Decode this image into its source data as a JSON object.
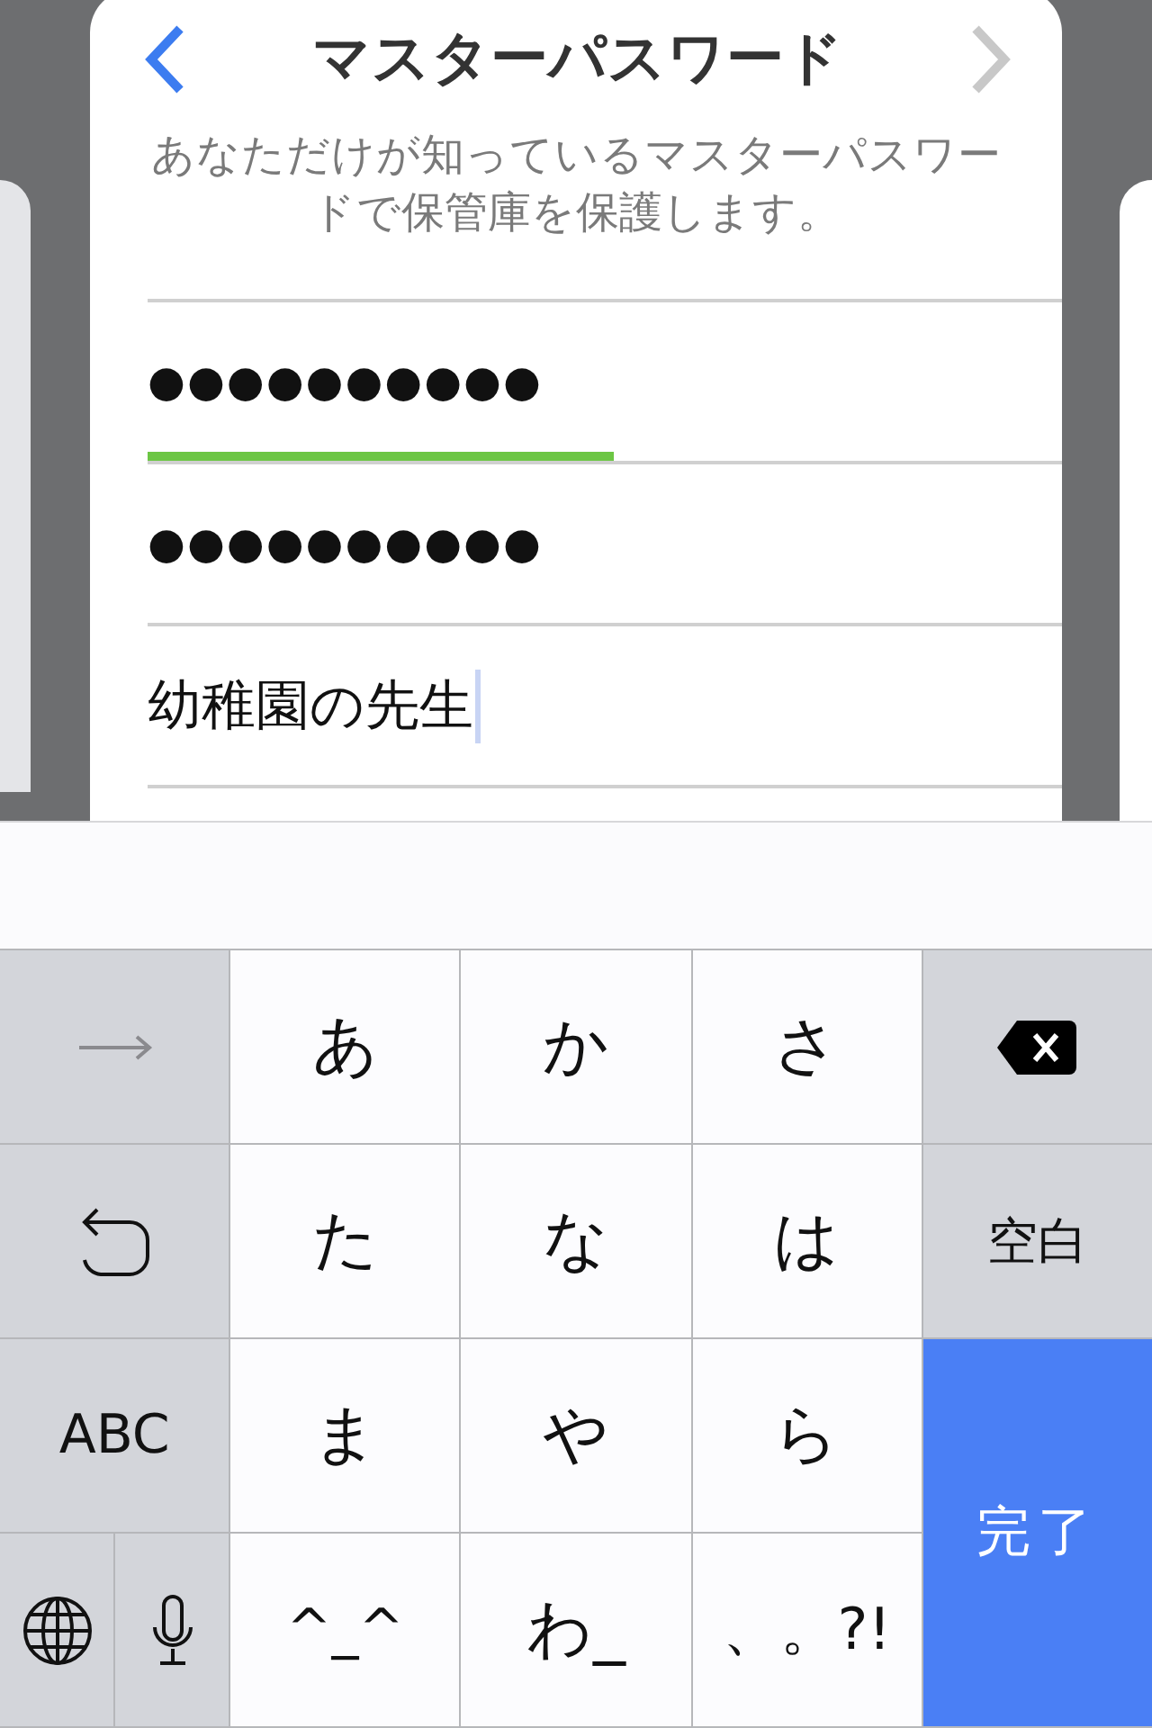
{
  "nav": {
    "title": "マスターパスワード",
    "back_enabled": true,
    "next_enabled": false
  },
  "description": "あなただけが知っているマスターパスワードで保管庫を保護します。",
  "fields": [
    {
      "kind": "password",
      "value": "●●●●●●●●●●",
      "focused": false,
      "level": 0.51
    },
    {
      "kind": "password",
      "value": "●●●●●●●●●●",
      "focused": false
    },
    {
      "kind": "text",
      "value": "幼稚園の先生",
      "focused": true
    }
  ],
  "keyboard": {
    "kana_keys": [
      "あ",
      "か",
      "さ",
      "た",
      "な",
      "は",
      "ま",
      "や",
      "ら",
      "^_^",
      "わ_",
      "、。?!"
    ],
    "abc_key": "ABC",
    "space_key": "空白",
    "done_key": "完了"
  }
}
